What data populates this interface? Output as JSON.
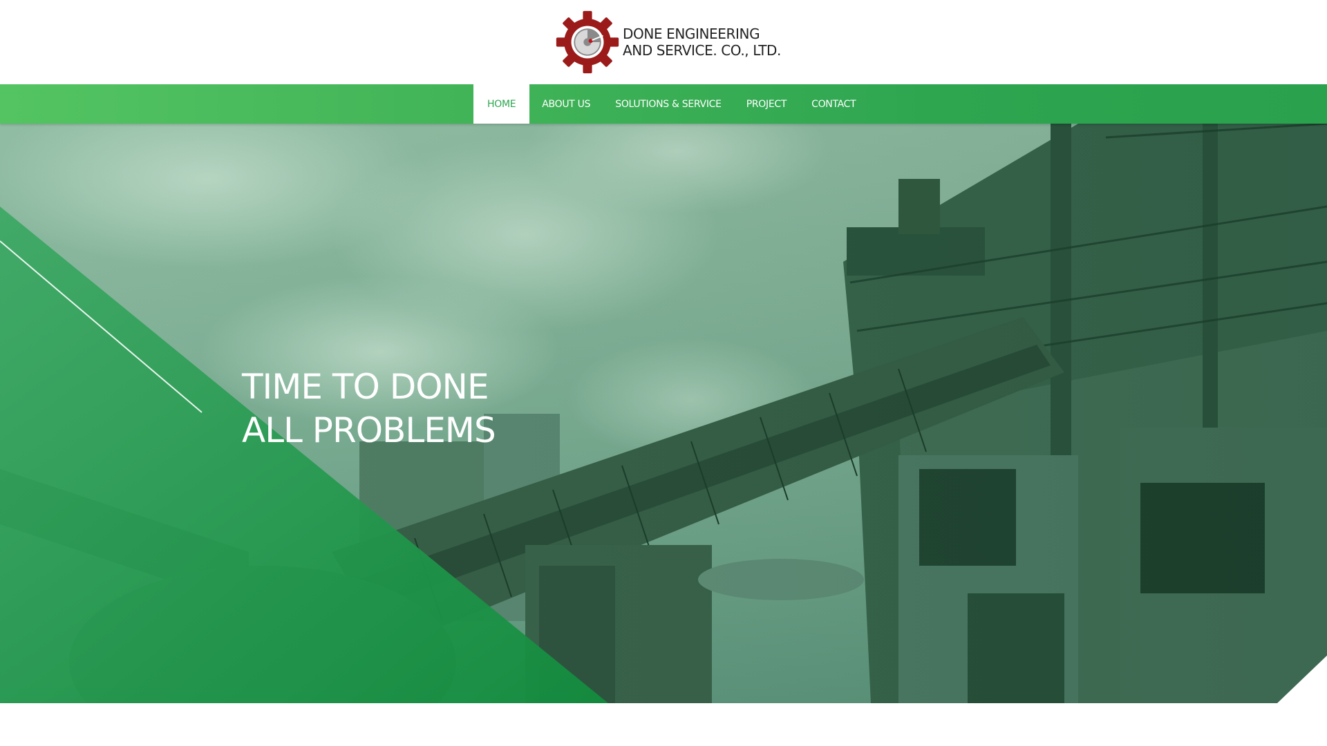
{
  "brand": {
    "name_line1": "DONE ENGINEERING",
    "name_line2": "AND SERVICE. CO., LTD.",
    "logo_icon": "gear-logo-icon",
    "logo_color": "#9b1a1a"
  },
  "nav": {
    "items": [
      {
        "label": "HOME",
        "active": true
      },
      {
        "label": "ABOUT US",
        "active": false
      },
      {
        "label": "SOLUTIONS & SERVICE",
        "active": false
      },
      {
        "label": "PROJECT",
        "active": false
      },
      {
        "label": "CONTACT",
        "active": false
      }
    ]
  },
  "hero": {
    "headline_line1": "TIME TO DONE",
    "headline_line2": "ALL PROBLEMS"
  },
  "colors": {
    "accent_green": "#2ea650",
    "nav_gradient_start": "#54c462",
    "overlay_green": "#1f8f45"
  }
}
